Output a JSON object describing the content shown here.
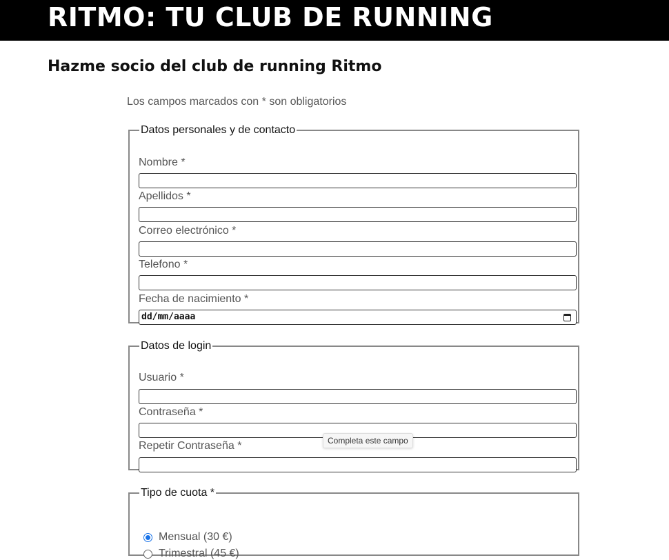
{
  "header": {
    "title": "RITMO: TU CLUB DE RUNNING"
  },
  "page": {
    "subtitle": "Hazme socio del club de running Ritmo",
    "required_note": "Los campos marcados con * son obligatorios"
  },
  "personal": {
    "legend": "Datos personales y de contacto",
    "nombre_label": "Nombre *",
    "nombre_value": "",
    "apellidos_label": "Apellidos *",
    "apellidos_value": "",
    "correo_label": "Correo electrónico *",
    "correo_value": "",
    "telefono_label": "Telefono *",
    "telefono_value": "",
    "fecha_label": "Fecha de nacimiento *",
    "fecha_placeholder": "dd/mm/aaaa"
  },
  "login": {
    "legend": "Datos de login",
    "usuario_label": "Usuario *",
    "usuario_value": "",
    "contrasena_label": "Contraseña *",
    "contrasena_value": "",
    "repetir_label": "Repetir Contraseña *",
    "repetir_value": "",
    "tooltip": "Completa este campo"
  },
  "cuota": {
    "legend": "Tipo de cuota *",
    "options": [
      {
        "label": "Mensual (30 €)",
        "checked": true
      },
      {
        "label": "Trimestral (45 €)",
        "checked": false
      }
    ]
  },
  "colors": {
    "header_bg": "#000000",
    "header_text": "#ffffff",
    "radio_accent": "#1a73e8"
  },
  "icons": {
    "date_picker": "calendar-icon"
  }
}
